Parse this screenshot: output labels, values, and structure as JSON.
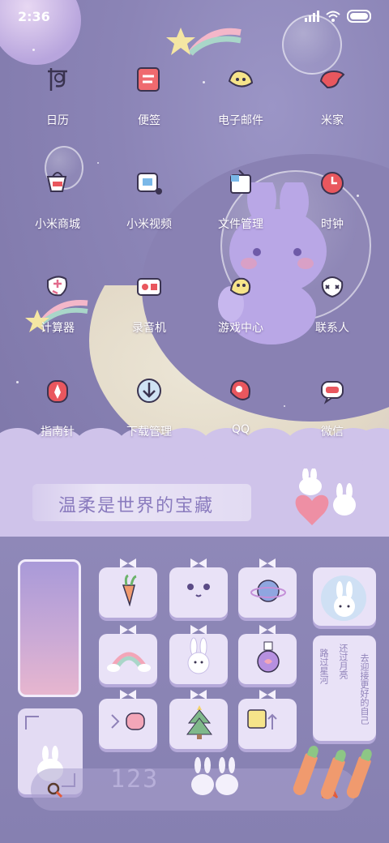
{
  "status_bar": {
    "time": "2:36"
  },
  "apps": [
    {
      "label": "日历",
      "icon": "calendar-icon"
    },
    {
      "label": "便签",
      "icon": "notes-icon"
    },
    {
      "label": "电子邮件",
      "icon": "mail-icon"
    },
    {
      "label": "米家",
      "icon": "home-icon"
    },
    {
      "label": "小米商城",
      "icon": "mall-icon"
    },
    {
      "label": "小米视频",
      "icon": "video-icon"
    },
    {
      "label": "文件管理",
      "icon": "files-icon"
    },
    {
      "label": "时钟",
      "icon": "clock-icon"
    },
    {
      "label": "计算器",
      "icon": "calculator-icon"
    },
    {
      "label": "录音机",
      "icon": "recorder-icon"
    },
    {
      "label": "游戏中心",
      "icon": "game-icon"
    },
    {
      "label": "联系人",
      "icon": "contacts-icon"
    },
    {
      "label": "指南针",
      "icon": "compass-icon"
    },
    {
      "label": "下载管理",
      "icon": "download-icon"
    },
    {
      "label": "QQ",
      "icon": "qq-icon"
    },
    {
      "label": "微信",
      "icon": "wechat-icon"
    }
  ],
  "banner": {
    "text": "温柔是世界的宝藏"
  },
  "quote_widget": {
    "col1": "路过星河",
    "col2": "还过月亮",
    "col3": "去迎接更好的自己"
  },
  "search_widget": {
    "text": "123"
  },
  "colors": {
    "accent": "#8a7bbe",
    "tile": "#e9e2f7",
    "tile_shadow": "#b5a9d9"
  }
}
